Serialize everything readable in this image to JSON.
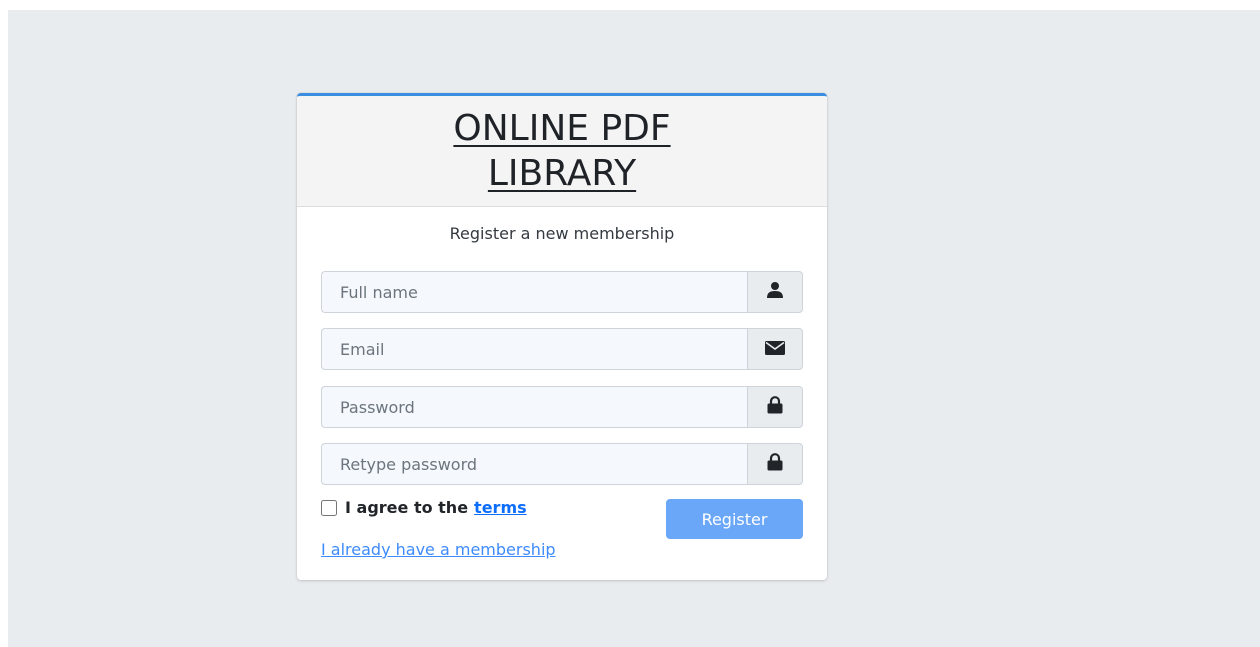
{
  "header": {
    "brand_line1": "ONLINE PDF",
    "brand_line2": "LIBRARY"
  },
  "form": {
    "message": "Register a new membership",
    "fields": [
      {
        "placeholder": "Full name",
        "value": "",
        "icon": "user-icon"
      },
      {
        "placeholder": "Email",
        "value": "",
        "icon": "envelope-icon"
      },
      {
        "placeholder": "Password",
        "value": "",
        "icon": "lock-icon"
      },
      {
        "placeholder": "Retype password",
        "value": "",
        "icon": "lock-icon"
      }
    ],
    "agree_text": "I agree to the",
    "terms_label": "terms",
    "terms_checked": false,
    "register_label": "Register",
    "membership_link": "I already have a membership"
  },
  "colors": {
    "background": "#e9ecef",
    "accent_border": "#3b8de0",
    "register_button": "#6aa7f8",
    "link": "#3d8bfd"
  }
}
